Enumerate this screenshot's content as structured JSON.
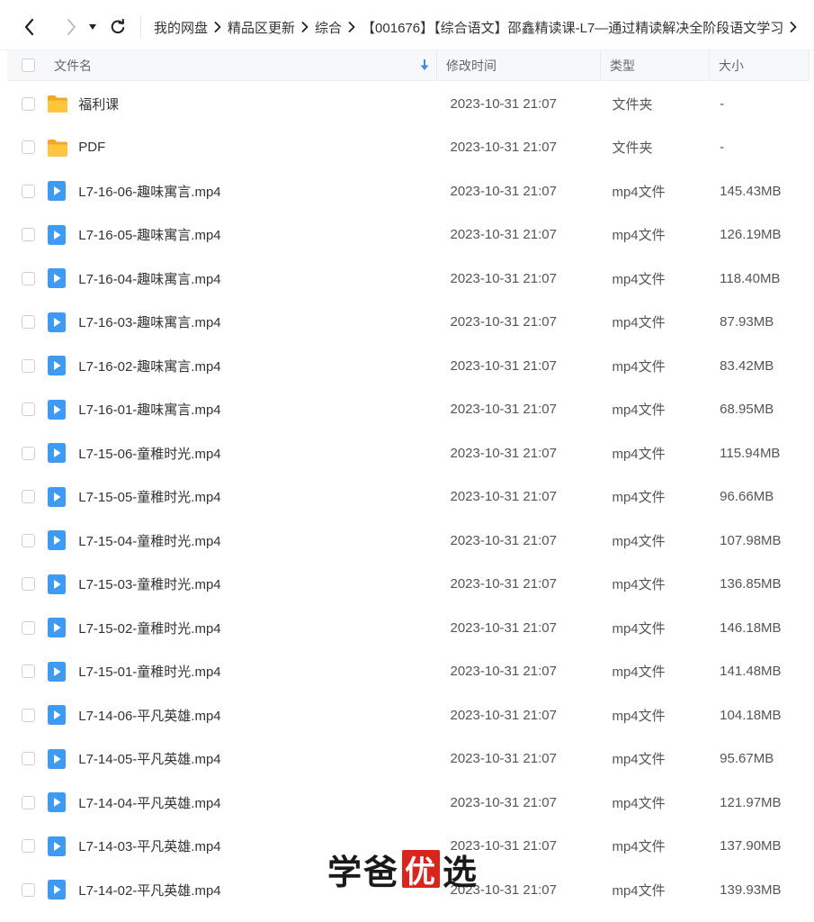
{
  "breadcrumb": [
    "我的网盘",
    "精品区更新",
    "综合",
    "【001676】【综合语文】邵鑫精读课-L7—通过精读解决全阶段语文学习"
  ],
  "columns": {
    "name": "文件名",
    "date": "修改时间",
    "type": "类型",
    "size": "大小"
  },
  "icons": {
    "back": "chevron-left-icon",
    "forward": "chevron-right-icon",
    "dropdown": "caret-down-icon",
    "refresh": "refresh-icon",
    "sort": "sort-down-icon",
    "folder": "folder-icon",
    "video": "video-file-icon"
  },
  "colors": {
    "folder": "#ffc53d",
    "video": "#3d9bf5",
    "watermark_badge": "#d9261c"
  },
  "files": [
    {
      "kind": "folder",
      "name": "福利课",
      "date": "2023-10-31 21:07",
      "type": "文件夹",
      "size": "-"
    },
    {
      "kind": "folder",
      "name": "PDF",
      "date": "2023-10-31 21:07",
      "type": "文件夹",
      "size": "-"
    },
    {
      "kind": "video",
      "name": "L7-16-06-趣味寓言.mp4",
      "date": "2023-10-31 21:07",
      "type": "mp4文件",
      "size": "145.43MB"
    },
    {
      "kind": "video",
      "name": "L7-16-05-趣味寓言.mp4",
      "date": "2023-10-31 21:07",
      "type": "mp4文件",
      "size": "126.19MB"
    },
    {
      "kind": "video",
      "name": "L7-16-04-趣味寓言.mp4",
      "date": "2023-10-31 21:07",
      "type": "mp4文件",
      "size": "118.40MB"
    },
    {
      "kind": "video",
      "name": "L7-16-03-趣味寓言.mp4",
      "date": "2023-10-31 21:07",
      "type": "mp4文件",
      "size": "87.93MB"
    },
    {
      "kind": "video",
      "name": "L7-16-02-趣味寓言.mp4",
      "date": "2023-10-31 21:07",
      "type": "mp4文件",
      "size": "83.42MB"
    },
    {
      "kind": "video",
      "name": "L7-16-01-趣味寓言.mp4",
      "date": "2023-10-31 21:07",
      "type": "mp4文件",
      "size": "68.95MB"
    },
    {
      "kind": "video",
      "name": "L7-15-06-童稚时光.mp4",
      "date": "2023-10-31 21:07",
      "type": "mp4文件",
      "size": "115.94MB"
    },
    {
      "kind": "video",
      "name": "L7-15-05-童稚时光.mp4",
      "date": "2023-10-31 21:07",
      "type": "mp4文件",
      "size": "96.66MB"
    },
    {
      "kind": "video",
      "name": "L7-15-04-童稚时光.mp4",
      "date": "2023-10-31 21:07",
      "type": "mp4文件",
      "size": "107.98MB"
    },
    {
      "kind": "video",
      "name": "L7-15-03-童稚时光.mp4",
      "date": "2023-10-31 21:07",
      "type": "mp4文件",
      "size": "136.85MB"
    },
    {
      "kind": "video",
      "name": "L7-15-02-童稚时光.mp4",
      "date": "2023-10-31 21:07",
      "type": "mp4文件",
      "size": "146.18MB"
    },
    {
      "kind": "video",
      "name": "L7-15-01-童稚时光.mp4",
      "date": "2023-10-31 21:07",
      "type": "mp4文件",
      "size": "141.48MB"
    },
    {
      "kind": "video",
      "name": "L7-14-06-平凡英雄.mp4",
      "date": "2023-10-31 21:07",
      "type": "mp4文件",
      "size": "104.18MB"
    },
    {
      "kind": "video",
      "name": "L7-14-05-平凡英雄.mp4",
      "date": "2023-10-31 21:07",
      "type": "mp4文件",
      "size": "95.67MB"
    },
    {
      "kind": "video",
      "name": "L7-14-04-平凡英雄.mp4",
      "date": "2023-10-31 21:07",
      "type": "mp4文件",
      "size": "121.97MB"
    },
    {
      "kind": "video",
      "name": "L7-14-03-平凡英雄.mp4",
      "date": "2023-10-31 21:07",
      "type": "mp4文件",
      "size": "137.90MB"
    },
    {
      "kind": "video",
      "name": "L7-14-02-平凡英雄.mp4",
      "date": "2023-10-31 21:07",
      "type": "mp4文件",
      "size": "139.93MB"
    }
  ],
  "watermark": {
    "before": "学爸",
    "badge": "优",
    "after": "选"
  }
}
